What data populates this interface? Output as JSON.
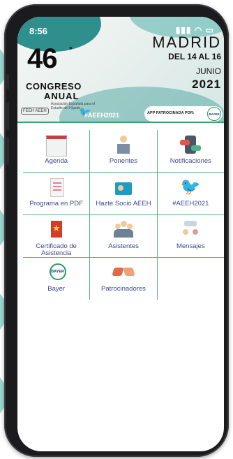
{
  "status": {
    "time": "8:56",
    "icons": "signal-wifi-battery"
  },
  "banner": {
    "number": "46",
    "degree": "°",
    "line1": "CONGRESO",
    "line2": "ANUAL",
    "association": "Asociación Española para el Estudio del Hígado",
    "city": "MADRID",
    "dates": "DEL 14 AL 16",
    "month": "JUNIO",
    "year": "2021",
    "org_short": "FEEH AEEH",
    "hashtag": "#AEEH2021",
    "sponsor_text": "APP PATROCINADA POR:",
    "sponsor_logo": "BAYER"
  },
  "menu": [
    [
      {
        "label": "Agenda",
        "icon": "calendar-icon"
      },
      {
        "label": "Ponentes",
        "icon": "speaker-podium-icon"
      },
      {
        "label": "Notificaciones",
        "icon": "phone-chat-icon"
      }
    ],
    [
      {
        "label": "Programa en PDF",
        "icon": "document-icon"
      },
      {
        "label": "Hazte Socio AEEH",
        "icon": "id-card-icon"
      },
      {
        "label": "#AEEH2021",
        "icon": "twitter-bird-icon"
      }
    ],
    [
      {
        "label": "Certificado de Asistencia",
        "icon": "certificate-star-icon"
      },
      {
        "label": "Asistentes",
        "icon": "people-group-icon"
      },
      {
        "label": "Mensajes",
        "icon": "chat-people-icon"
      }
    ],
    [
      {
        "label": "Bayer",
        "icon": "bayer-logo-icon"
      },
      {
        "label": "Patrocinadores",
        "icon": "handshake-icon"
      }
    ]
  ],
  "colors": {
    "accent_green": "#3aa36a",
    "label_blue": "#3d4a8a",
    "teal": "#9ed6d0"
  }
}
